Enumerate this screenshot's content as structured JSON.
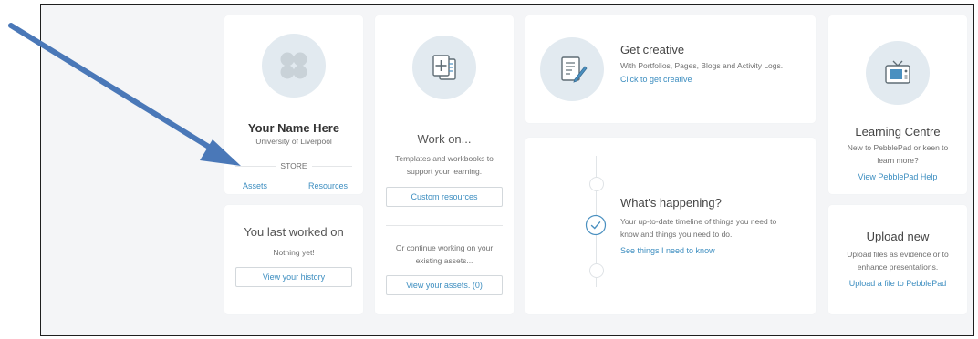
{
  "profile": {
    "name": "Your Name Here",
    "institution": "University of Liverpool",
    "store_label": "STORE",
    "assets_link": "Assets",
    "resources_link": "Resources"
  },
  "last_worked": {
    "title": "You last worked on",
    "status": "Nothing yet!",
    "button": "View your history"
  },
  "work_on": {
    "title": "Work on...",
    "description_1": "Templates and workbooks to",
    "description_2": "support your learning.",
    "custom_button": "Custom resources",
    "continue_1": "Or continue working on your",
    "continue_2": "existing assets...",
    "assets_button": "View your assets. (0)"
  },
  "get_creative": {
    "title": "Get creative",
    "description": "With Portfolios, Pages, Blogs and Activity Logs.",
    "link": "Click to get creative"
  },
  "whats_happening": {
    "title": "What's happening?",
    "description_1": "Your up-to-date timeline of things you need to",
    "description_2": "know and things you need to do.",
    "link": "See things I need to know"
  },
  "learning_centre": {
    "title": "Learning Centre",
    "description_1": "New to PebblePad or keen to",
    "description_2": "learn more?",
    "link": "View PebblePad Help"
  },
  "upload": {
    "title": "Upload new",
    "description_1": "Upload files as evidence or to",
    "description_2": "enhance presentations.",
    "link": "Upload a file to PebblePad"
  },
  "colors": {
    "link_blue": "#3d8ec0",
    "arrow_blue": "#4a78b8",
    "icon_circle": "#e2eaf0",
    "page_bg": "#f4f5f7"
  }
}
